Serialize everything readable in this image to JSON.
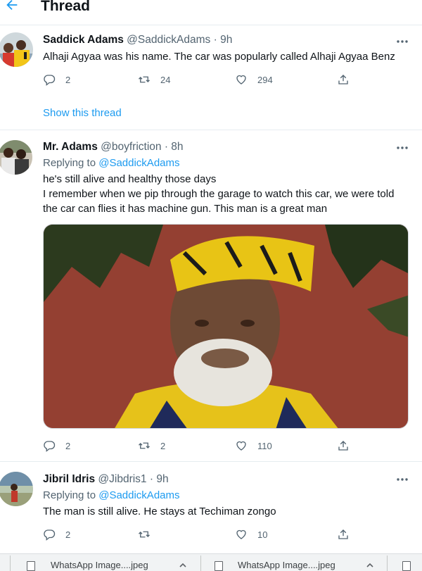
{
  "header": {
    "title": "Thread"
  },
  "tweets": [
    {
      "name": "Saddick Adams",
      "handle": "@SaddickAdams",
      "time": "· 9h",
      "text": "Alhaji Agyaa was his name. The car was popularly called Alhaji Agyaa Benz",
      "replies": "2",
      "retweets": "24",
      "likes": "294",
      "show_thread": "Show this thread"
    },
    {
      "name": "Mr. Adams",
      "handle": "@boyfriction",
      "time": "· 8h",
      "replying_label": "Replying to",
      "replying_handle": "@SaddickAdams",
      "lines": [
        "he's still alive and healthy those days",
        "I remember when we pip through the garage to watch this car, we were told",
        "the car can flies it has machine gun. This man is a great man"
      ],
      "replies": "2",
      "retweets": "2",
      "likes": "110"
    },
    {
      "name": "Jibril Idris",
      "handle": "@Jibdris1",
      "time": "· 9h",
      "replying_label": "Replying to",
      "replying_handle": "@SaddickAdams",
      "text": "The man is still alive. He stays at Techiman zongo",
      "replies": "2",
      "retweets": "",
      "likes": "10"
    }
  ],
  "downloads": [
    {
      "label": "WhatsApp Image....jpeg"
    },
    {
      "label": "WhatsApp Image....jpeg"
    }
  ],
  "colors": {
    "accent": "#1d9bf0",
    "muted": "#536471",
    "text": "#0f1419",
    "border": "#e6ecf0"
  }
}
